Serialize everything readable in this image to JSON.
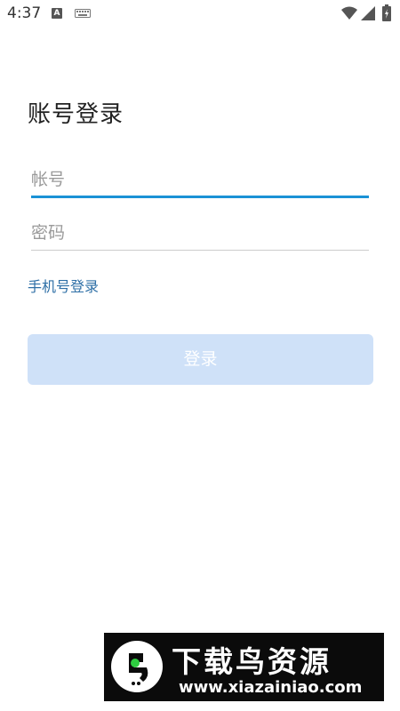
{
  "status_bar": {
    "time": "4:37",
    "icons": [
      "a-notification-icon",
      "keyboard-icon",
      "wifi-icon",
      "cell-signal-icon",
      "battery-icon"
    ]
  },
  "login": {
    "title": "账号登录",
    "account_placeholder": "帐号",
    "account_value": "",
    "password_placeholder": "密码",
    "password_value": "",
    "phone_login_label": "手机号登录",
    "login_button_label": "登录"
  },
  "colors": {
    "accent": "#1a92d6",
    "link": "#2e6fa6",
    "button_disabled": "#cfe1f8"
  },
  "watermark": {
    "title": "下载鸟资源",
    "url": "www.xiazainiao.com"
  }
}
